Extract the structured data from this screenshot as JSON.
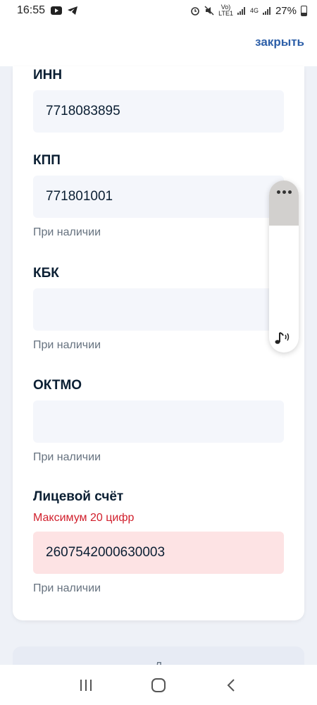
{
  "status_bar": {
    "time": "16:55",
    "battery": "27%",
    "network_label": "LTE1",
    "network_type": "4G"
  },
  "header": {
    "close_label": "закрыть"
  },
  "form": {
    "inn": {
      "label": "ИНН",
      "value": "7718083895"
    },
    "kpp": {
      "label": "КПП",
      "value": "771801001",
      "hint": "При наличии"
    },
    "kbk": {
      "label": "КБК",
      "value": "",
      "hint": "При наличии"
    },
    "oktmo": {
      "label": "ОКТМО",
      "value": "",
      "hint": "При наличии"
    },
    "account": {
      "label": "Лицевой счёт",
      "error": "Максимум 20 цифр",
      "value": "2607542000630003",
      "hint": "При наличии"
    }
  },
  "next_button": {
    "label": "Д"
  },
  "colors": {
    "accent": "#2d5fa8",
    "error": "#d1202d",
    "error_bg": "#fde3e4",
    "input_bg": "#f4f6fb"
  },
  "icons": [
    "youtube-icon",
    "telegram-icon",
    "alarm-icon",
    "mute-icon",
    "signal-icon",
    "battery-icon",
    "more-dots-icon",
    "audio-note-icon",
    "recents-icon",
    "home-icon",
    "back-icon"
  ]
}
